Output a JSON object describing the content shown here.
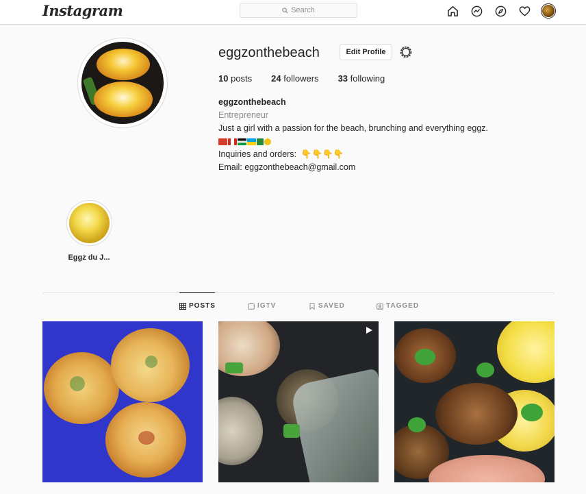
{
  "nav": {
    "logo": "Instagram",
    "search_placeholder": "Search",
    "icons": [
      "home-icon",
      "messenger-icon",
      "explore-icon",
      "heart-icon",
      "profile-avatar"
    ]
  },
  "profile": {
    "username": "eggzonthebeach",
    "edit_button": "Edit Profile",
    "stats": {
      "posts_count": "10",
      "posts_label": "posts",
      "followers_count": "24",
      "followers_label": "followers",
      "following_count": "33",
      "following_label": "following"
    },
    "bio": {
      "name": "eggzonthebeach",
      "category": "Entrepreneur",
      "line1": "Just a girl with a passion for the beach, brunching and everything eggz.",
      "inquiries": "Inquiries and orders:",
      "inquiries_emoji": "👇👇👇👇",
      "email": "Email: eggzonthebeach@gmail.com"
    }
  },
  "highlights": [
    {
      "label": "Eggz du J..."
    }
  ],
  "tabs": [
    {
      "label": "POSTS",
      "icon": "grid-icon",
      "active": true
    },
    {
      "label": "IGTV",
      "icon": "igtv-icon",
      "active": false
    },
    {
      "label": "SAVED",
      "icon": "bookmark-icon",
      "active": false
    },
    {
      "label": "TAGGED",
      "icon": "tag-icon",
      "active": false
    }
  ],
  "colors": {
    "accent_text": "#262626",
    "muted_text": "#8e8e8e",
    "border": "#dbdbdb"
  }
}
